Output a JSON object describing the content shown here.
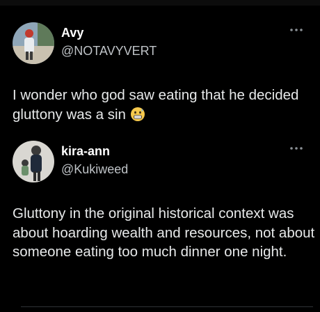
{
  "tweets": [
    {
      "name": "Avy",
      "handle": "@NOTAVYVERT",
      "text": "I wonder who god saw eating that he decided gluttony was a sin",
      "emoji": "grimacing-sweat-face-icon",
      "more_icon": "more-horizontal-icon",
      "avatar": "profile-avatar"
    },
    {
      "name": "kira-ann",
      "handle": "@Kukiweed",
      "text": "Gluttony in the original historical context was about hoarding wealth and resources, not about someone eating too much dinner one night.",
      "more_icon": "more-horizontal-icon",
      "avatar": "profile-avatar"
    }
  ],
  "colors": {
    "background": "#000000",
    "primary_text": "#e7e9ea",
    "secondary_text": "#bfc3c7",
    "name_text": "#ffffff"
  }
}
